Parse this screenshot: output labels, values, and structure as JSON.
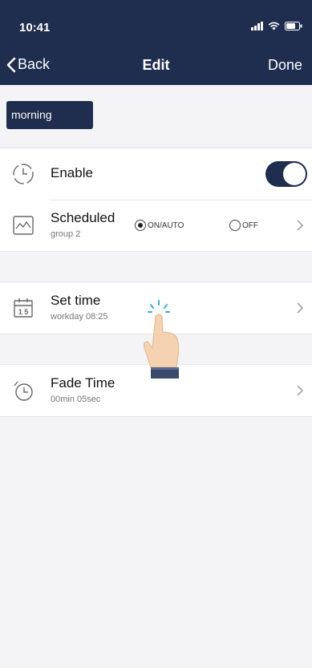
{
  "status_bar": {
    "time": "10:41"
  },
  "nav": {
    "back_label": "Back",
    "title": "Edit",
    "done_label": "Done"
  },
  "schedule_name": "morning",
  "rows": {
    "enable": {
      "title": "Enable",
      "enabled": true,
      "icon": "clock-icon"
    },
    "scheduled": {
      "title": "Scheduled",
      "subtitle": "group 2",
      "icon": "scene-image-icon",
      "options": [
        {
          "label": "ON/AUTO",
          "selected": true
        },
        {
          "label": "OFF",
          "selected": false
        }
      ]
    },
    "set_time": {
      "title": "Set time",
      "subtitle": "workday 08:25",
      "icon": "calendar-icon"
    },
    "fade_time": {
      "title": "Fade Time",
      "subtitle": "00min 05sec",
      "icon": "alarm-clock-icon"
    }
  },
  "colors": {
    "header": "#1f2d4e",
    "background": "#f4f4f6",
    "toggle_on": "#1f2d4e"
  },
  "overlay": {
    "icon": "tap-hand-icon"
  }
}
